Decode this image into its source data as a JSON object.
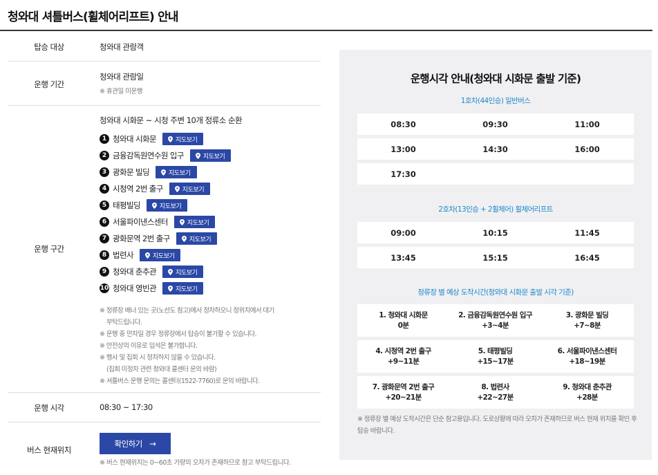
{
  "page": {
    "title": "청와대 셔틀버스(휠체어리프트) 안내"
  },
  "info": {
    "target": {
      "label": "탑승 대상",
      "value": "청와대 관람객"
    },
    "period": {
      "label": "운행 기간",
      "value": "청와대 관람일",
      "note": "※ 휴관일 미운행"
    },
    "route": {
      "label": "운행 구간",
      "summary": "청와대 시화문 ~ 시청 주변 10개 정류소 순환",
      "map_button_label": "지도보기",
      "stops": [
        {
          "num": "1",
          "name": "청와대 시화문"
        },
        {
          "num": "2",
          "name": "금융감독원연수원 입구"
        },
        {
          "num": "3",
          "name": "광화문 빌딩"
        },
        {
          "num": "4",
          "name": "시청역 2번 출구"
        },
        {
          "num": "5",
          "name": "태평빌딩"
        },
        {
          "num": "6",
          "name": "서울파이낸스센터"
        },
        {
          "num": "7",
          "name": "광화문역 2번 출구"
        },
        {
          "num": "8",
          "name": "법련사"
        },
        {
          "num": "9",
          "name": "청와대 춘추관"
        },
        {
          "num": "10",
          "name": "청와대 영빈관"
        }
      ],
      "notes": [
        "※ 정류장 배너 있는 곳(노선도 참고)에서 정차하오니 정위치에서 대기",
        "부탁드립니다.",
        "※ 운행 중 만차일 경우 정류장에서 탑승이 불가할 수 있습니다.",
        "※ 안전상의 이유로 입석은 불가합니다.",
        "※ 행사 및 집회 시 정차하지 않을 수 있습니다.",
        "(집회 미정차 관련 청와대 콜센터 문의 바람)",
        "※ 셔틀버스 운행 문의는 콜센터(1522-7760)로 문의 바랍니다."
      ]
    },
    "time": {
      "label": "운행 시각",
      "value": "08:30 ~ 17:30"
    },
    "location": {
      "label": "버스 현재위치",
      "button_label": "확인하기",
      "note": "※ 버스 현재위치는 0~60초 가량의 오차가 존재하므로 참고 부탁드립니다."
    }
  },
  "timetable": {
    "title": "운행시각 안내(청와대 시화문 출발 기준)",
    "bus1": {
      "title": "1호차(44인승) 일반버스",
      "rows": [
        [
          "08:30",
          "09:30",
          "11:00"
        ],
        [
          "13:00",
          "14:30",
          "16:00"
        ],
        [
          "17:30",
          "",
          ""
        ]
      ]
    },
    "bus2": {
      "title": "2호차(13인승 + 2휠체어) 휠체어리프트",
      "rows": [
        [
          "09:00",
          "10:15",
          "11:45"
        ],
        [
          "13:45",
          "15:15",
          "16:45"
        ]
      ]
    },
    "eta": {
      "title": "정류장 별 예상 도착시간(청와대 시화문 출발 시각 기준)",
      "rows": [
        [
          {
            "name": "1. 청와대 시화문",
            "time": "0분"
          },
          {
            "name": "2. 금융감독원연수원 입구",
            "time": "+3~4분"
          },
          {
            "name": "3. 광화문 빌딩",
            "time": "+7~8분"
          }
        ],
        [
          {
            "name": "4. 시청역 2번 출구",
            "time": "+9~11분"
          },
          {
            "name": "5. 태평빌딩",
            "time": "+15~17분"
          },
          {
            "name": "6. 서울파이낸스센터",
            "time": "+18~19분"
          }
        ],
        [
          {
            "name": "7. 광화문역 2번 출구",
            "time": "+20~21분"
          },
          {
            "name": "8. 법련사",
            "time": "+22~27분"
          },
          {
            "name": "9. 청와대 춘추관",
            "time": "+28분"
          }
        ]
      ],
      "note": "※ 정류장 별 예상 도착시간은 단순 참고용입니다. 도로상황에 따라 오차가 존재하므로 버스 현재 위치를 확인 후 탑승 바랍니다."
    }
  },
  "colors": {
    "accent": "#2b48a6",
    "section_title": "#2089c8",
    "panel_bg": "#f0f0f3"
  }
}
